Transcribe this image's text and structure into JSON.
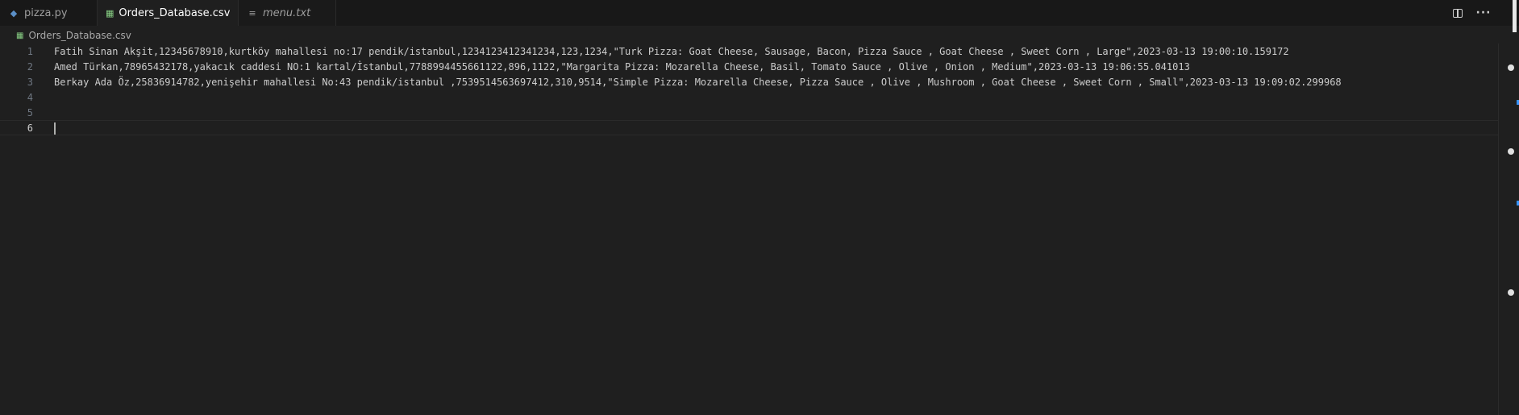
{
  "tabs": [
    {
      "label": "pizza.py",
      "icon": "python-file-icon"
    },
    {
      "label": "Orders_Database.csv",
      "icon": "csv-file-icon",
      "active": true,
      "dirty": true
    },
    {
      "label": "menu.txt",
      "icon": "text-file-icon",
      "preview": true
    }
  ],
  "breadcrumb": {
    "file": "Orders_Database.csv"
  },
  "editor": {
    "lines": [
      {
        "number": "1",
        "text": "Fatih Sinan Akşit,12345678910,kurtköy mahallesi no:17 pendik/istanbul,1234123412341234,123,1234,\"Turk Pizza: Goat Cheese, Sausage, Bacon, Pizza Sauce , Goat Cheese , Sweet Corn , Large\",2023-03-13 19:00:10.159172"
      },
      {
        "number": "2",
        "text": "Amed Türkan,78965432178,yakacık caddesi NO:1 kartal/İstanbul,7788994455661122,896,1122,\"Margarita Pizza: Mozarella Cheese, Basil, Tomato Sauce , Olive , Onion , Medium\",2023-03-13 19:06:55.041013"
      },
      {
        "number": "3",
        "text": "Berkay Ada Öz,25836914782,yenişehir mahallesi No:43 pendik/istanbul ,7539514563697412,310,9514,\"Simple Pizza: Mozarella Cheese, Pizza Sauce , Olive , Mushroom , Goat Cheese , Sweet Corn , Small\",2023-03-13 19:09:02.299968"
      },
      {
        "number": "4",
        "text": ""
      },
      {
        "number": "5",
        "text": ""
      },
      {
        "number": "6",
        "text": ""
      }
    ]
  },
  "colors": {
    "background": "#1f1f1f",
    "tabbar": "#181818",
    "csv_icon": "#89d185",
    "python_icon": "#5b8fc7"
  }
}
